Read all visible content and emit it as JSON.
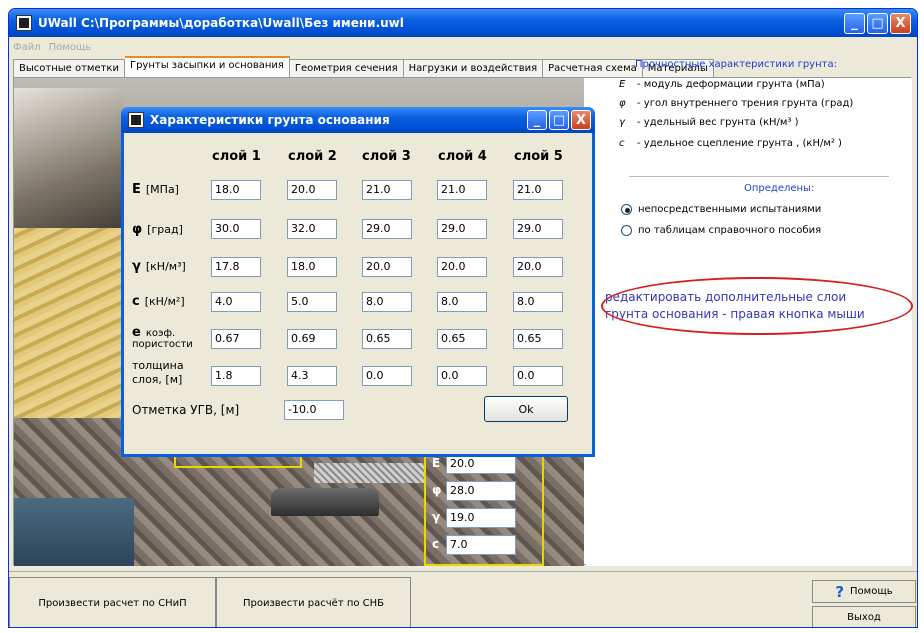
{
  "window": {
    "title": "UWall  C:\\Программы\\доработка\\Uwall\\Без имени.uwl",
    "minimize": "_",
    "maximize": "□",
    "close": "X"
  },
  "menu": [
    "Файл",
    "Помощь"
  ],
  "tabs": [
    "Высотные отметки",
    "Грунты засыпки и основания",
    "Геометрия сечения",
    "Нагрузки и воздействия",
    "Расчетная схема",
    "Материалы"
  ],
  "scene_fields": [
    {
      "label": "E",
      "value": "20.0"
    },
    {
      "label": "φ",
      "value": "28.0"
    },
    {
      "label": "γ",
      "value": "19.0"
    },
    {
      "label": "c",
      "value": "7.0"
    }
  ],
  "legend": {
    "title": "Прочностные характеристики грунта:",
    "items": [
      {
        "sym": "E",
        "text": "- модуль деформации грунта (мПа)"
      },
      {
        "sym": "φ",
        "text": "- угол внутреннего трения грунта (град)"
      },
      {
        "sym": "γ",
        "text": "- удельный вес грунта (кН/м³ )"
      },
      {
        "sym": "c",
        "text": "- удельное сцепление грунта , (кН/м² )"
      }
    ]
  },
  "defined": {
    "title": "Определены:",
    "options": [
      {
        "label": "непосредственными испытаниями",
        "selected": true
      },
      {
        "label": "по таблицам справочного пособия",
        "selected": false
      }
    ]
  },
  "hint": {
    "line1": "редактировать дополнительные слои",
    "line2": "грунта основания - правая кнопка мыши"
  },
  "bottom": {
    "calc_snip": "Произвести расчет по СНиП",
    "calc_snb": "Произвести расчёт по СНБ",
    "help": "Помощь",
    "exit": "Выход"
  },
  "dialog": {
    "title": "Характеристики грунта основания",
    "columns": [
      "слой 1",
      "слой 2",
      "слой 3",
      "слой 4",
      "слой 5"
    ],
    "rows": [
      {
        "sym": "E",
        "unit": "[МПа]",
        "values": [
          "18.0",
          "20.0",
          "21.0",
          "21.0",
          "21.0"
        ]
      },
      {
        "sym": "φ",
        "unit": "[град]",
        "values": [
          "30.0",
          "32.0",
          "29.0",
          "29.0",
          "29.0"
        ]
      },
      {
        "sym": "γ",
        "unit": "[кН/м³]",
        "values": [
          "17.8",
          "18.0",
          "20.0",
          "20.0",
          "20.0"
        ]
      },
      {
        "sym": "c",
        "unit": "[кН/м²]",
        "values": [
          "4.0",
          "5.0",
          "8.0",
          "8.0",
          "8.0"
        ]
      },
      {
        "sym": "e",
        "unit": "коэф. пористости",
        "values": [
          "0.67",
          "0.69",
          "0.65",
          "0.65",
          "0.65"
        ]
      },
      {
        "sym": "",
        "unit": "толщина слоя, [м]",
        "values": [
          "1.8",
          "4.3",
          "0.0",
          "0.0",
          "0.0"
        ]
      }
    ],
    "ugv_label": "Отметка УГВ, [м]",
    "ugv_value": "-10.0",
    "ok": "Ok"
  },
  "colors": {
    "title_blue": "#0a5fe0",
    "accent_text": "#1c3ed8",
    "hint_text": "#3535b8",
    "ellipse_red": "#d42020",
    "highlight_yellow": "#e8d800"
  }
}
